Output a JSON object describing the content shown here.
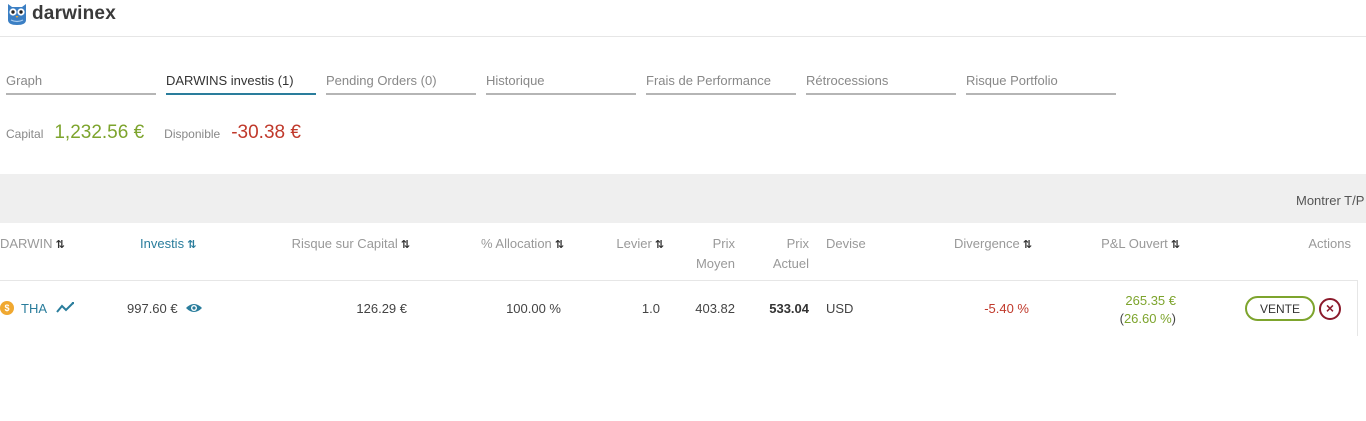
{
  "app": {
    "logo_text": "darwinex"
  },
  "tabs": [
    {
      "label": "Graph",
      "active": false
    },
    {
      "label": "DARWINS investis (1)",
      "active": true
    },
    {
      "label": "Pending Orders (0)",
      "active": false
    },
    {
      "label": "Historique",
      "active": false
    },
    {
      "label": "Frais de Performance",
      "active": false
    },
    {
      "label": "Rétrocessions",
      "active": false
    },
    {
      "label": "Risque Portfolio",
      "active": false
    }
  ],
  "summary": {
    "capital_label": "Capital",
    "capital_value": "1,232.56 €",
    "disponible_label": "Disponible",
    "disponible_value": "-30.38 €"
  },
  "toolbar": {
    "montrer_label": "Montrer T/P"
  },
  "table": {
    "headers": {
      "darwin": "DARWIN",
      "investis": "Investis",
      "risque": "Risque sur Capital",
      "allocation": "% Allocation",
      "levier": "Levier",
      "prix_moyen_1": "Prix",
      "prix_moyen_2": "Moyen",
      "prix_actuel_1": "Prix",
      "prix_actuel_2": "Actuel",
      "devise": "Devise",
      "divergence": "Divergence",
      "pl_ouvert": "P&L Ouvert",
      "actions": "Actions"
    },
    "sort_glyph": "⇅",
    "rows": [
      {
        "coin_symbol": "$",
        "darwin": "THA",
        "investis": "997.60 €",
        "risque": "126.29 €",
        "allocation": "100.00 %",
        "levier": "1.0",
        "prix_moyen": "403.82",
        "prix_actuel": "533.04",
        "devise": "USD",
        "divergence": "-5.40 %",
        "pl_value": "265.35 €",
        "pl_pct_open": "(",
        "pl_pct": "26.60 %",
        "pl_pct_close": ")",
        "sell_label": "VENTE"
      }
    ]
  },
  "icons": {
    "logo": "owl-logo-icon",
    "chart": "trend-chart-icon",
    "eye": "eye-icon",
    "close": "close-circle-icon",
    "coin": "dollar-coin-icon"
  },
  "colors": {
    "accent": "#2a7d9c",
    "positive": "#7da42d",
    "negative": "#c0392b",
    "close": "#8b1a2b"
  }
}
